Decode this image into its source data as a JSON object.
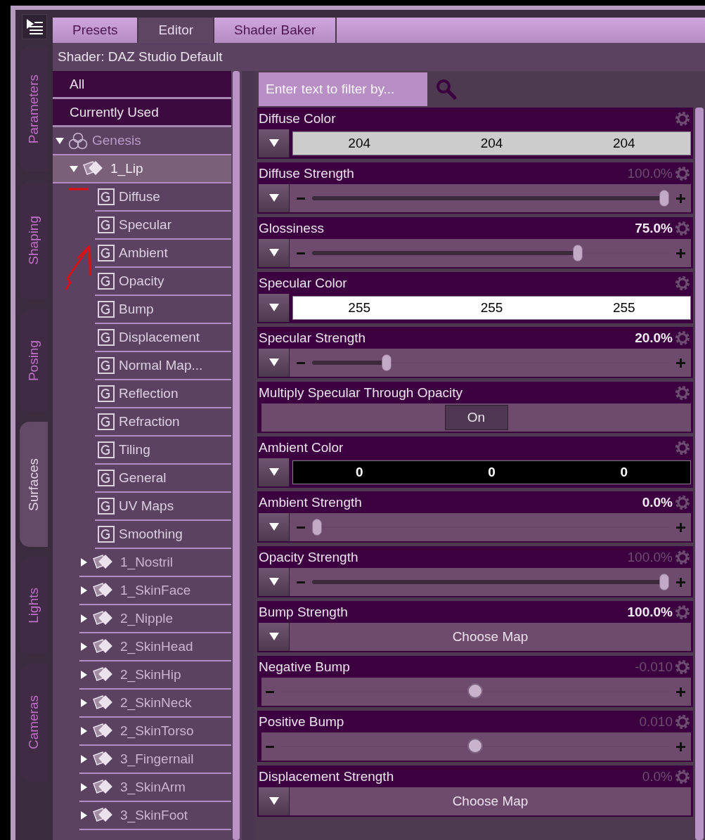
{
  "side_tabs": [
    {
      "label": "Parameters",
      "selected": false
    },
    {
      "label": "Shaping",
      "selected": false
    },
    {
      "label": "Posing",
      "selected": false
    },
    {
      "label": "Surfaces",
      "selected": true
    },
    {
      "label": "Lights",
      "selected": false
    },
    {
      "label": "Cameras",
      "selected": false
    }
  ],
  "tabs": [
    {
      "label": "Presets",
      "selected": false
    },
    {
      "label": "Editor",
      "selected": true
    },
    {
      "label": "Shader Baker",
      "selected": false
    }
  ],
  "shader_label": "Shader: DAZ Studio Default",
  "filters": [
    {
      "label": "All",
      "selected": false
    },
    {
      "label": "Currently Used",
      "selected": false
    }
  ],
  "tree": [
    {
      "label": "Genesis",
      "kind": "figure",
      "expanded": true,
      "selected": false,
      "children": [
        {
          "label": "1_Lip",
          "kind": "surface",
          "expanded": true,
          "selected": true,
          "children": [
            {
              "label": "Diffuse",
              "kind": "group",
              "selected": false
            },
            {
              "label": "Specular",
              "kind": "group",
              "selected": false
            },
            {
              "label": "Ambient",
              "kind": "group",
              "selected": false
            },
            {
              "label": "Opacity",
              "kind": "group",
              "selected": false
            },
            {
              "label": "Bump",
              "kind": "group",
              "selected": false
            },
            {
              "label": "Displacement",
              "kind": "group",
              "selected": false
            },
            {
              "label": "Normal Map...",
              "kind": "group",
              "selected": false
            },
            {
              "label": "Reflection",
              "kind": "group",
              "selected": false
            },
            {
              "label": "Refraction",
              "kind": "group",
              "selected": false
            },
            {
              "label": "Tiling",
              "kind": "group",
              "selected": false
            },
            {
              "label": "General",
              "kind": "group",
              "selected": false
            },
            {
              "label": "UV Maps",
              "kind": "group",
              "selected": false
            },
            {
              "label": "Smoothing",
              "kind": "group",
              "selected": false
            }
          ]
        },
        {
          "label": "1_Nostril",
          "kind": "surface",
          "expanded": false,
          "selected": false
        },
        {
          "label": "1_SkinFace",
          "kind": "surface",
          "expanded": false,
          "selected": false
        },
        {
          "label": "2_Nipple",
          "kind": "surface",
          "expanded": false,
          "selected": false
        },
        {
          "label": "2_SkinHead",
          "kind": "surface",
          "expanded": false,
          "selected": false
        },
        {
          "label": "2_SkinHip",
          "kind": "surface",
          "expanded": false,
          "selected": false
        },
        {
          "label": "2_SkinNeck",
          "kind": "surface",
          "expanded": false,
          "selected": false
        },
        {
          "label": "2_SkinTorso",
          "kind": "surface",
          "expanded": false,
          "selected": false
        },
        {
          "label": "3_Fingernail",
          "kind": "surface",
          "expanded": false,
          "selected": false
        },
        {
          "label": "3_SkinArm",
          "kind": "surface",
          "expanded": false,
          "selected": false
        },
        {
          "label": "3_SkinFoot",
          "kind": "surface",
          "expanded": false,
          "selected": false
        }
      ]
    }
  ],
  "filter_field": {
    "placeholder": "Enter text to filter by..."
  },
  "properties": [
    {
      "name": "Diffuse Color",
      "kind": "color",
      "values": [
        "204",
        "204",
        "204"
      ],
      "color": "#cccccc"
    },
    {
      "name": "Diffuse Strength",
      "kind": "slider",
      "value": "100.0%",
      "dimmed": true,
      "level": 1
    },
    {
      "name": "Glossiness",
      "kind": "slider",
      "value": "75.0%",
      "dimmed": false,
      "level": 0.75
    },
    {
      "name": "Specular Color",
      "kind": "color",
      "values": [
        "255",
        "255",
        "255"
      ],
      "color": "#ffffff"
    },
    {
      "name": "Specular Strength",
      "kind": "slider",
      "value": "20.0%",
      "dimmed": false,
      "level": 0.2
    },
    {
      "name": "Multiply Specular Through Opacity",
      "kind": "toggle",
      "label": "On",
      "on": true
    },
    {
      "name": "Ambient Color",
      "kind": "color",
      "values": [
        "0",
        "0",
        "0"
      ],
      "color": "#000000"
    },
    {
      "name": "Ambient Strength",
      "kind": "slider",
      "value": "0.0%",
      "dimmed": false,
      "level": 0
    },
    {
      "name": "Opacity Strength",
      "kind": "slider",
      "value": "100.0%",
      "dimmed": true,
      "level": 1
    },
    {
      "name": "Bump Strength",
      "kind": "map",
      "value": "100.0%",
      "dimmed": false,
      "label": "Choose Map"
    },
    {
      "name": "Negative Bump",
      "kind": "offset",
      "value": "-0.010",
      "dimmed": true,
      "level": 0.5
    },
    {
      "name": "Positive Bump",
      "kind": "offset",
      "value": "0.010",
      "dimmed": true,
      "level": 0.5
    },
    {
      "name": "Displacement Strength",
      "kind": "map",
      "value": "0.0%",
      "dimmed": true,
      "label": "Choose Map"
    }
  ],
  "annotations": [
    {
      "kind": "underline"
    },
    {
      "kind": "arrow"
    }
  ]
}
